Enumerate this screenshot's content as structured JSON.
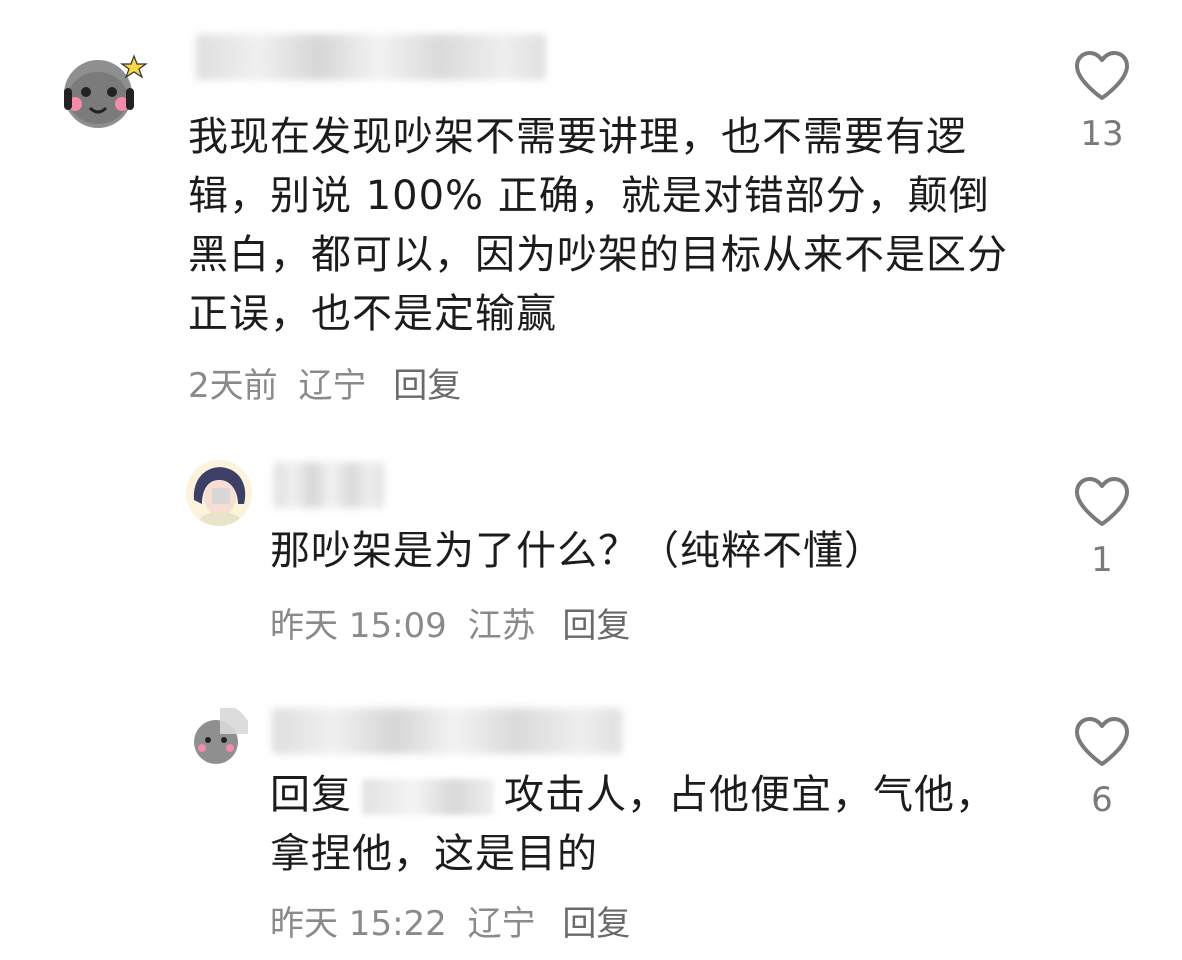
{
  "comments": [
    {
      "text": "我现在发现吵架不需要讲理，也不需要有逻辑，别说 100% 正确，就是对错部分，颠倒黑白，都可以，因为吵架的目标从来不是区分正误，也不是定输赢",
      "time": "2天前",
      "location": "辽宁",
      "reply_label": "回复",
      "likes": "13",
      "avatar_icon": "cartoon-face-icon"
    },
    {
      "text": "那吵架是为了什么？（纯粹不懂）",
      "time": "昨天 15:09",
      "location": "江苏",
      "reply_label": "回复",
      "likes": "1",
      "avatar_icon": "anime-girl-icon"
    },
    {
      "prefix": "回复",
      "text": "攻击人，占他便宜，气他，拿捏他，这是目的",
      "time": "昨天 15:22",
      "location": "辽宁",
      "reply_label": "回复",
      "likes": "6",
      "avatar_icon": "cartoon-face-icon"
    }
  ],
  "icons": {
    "like": "heart-outline-icon"
  },
  "colors": {
    "text": "#1c1c1c",
    "meta": "#8a8a8a",
    "heart": "#7a7a7a"
  }
}
